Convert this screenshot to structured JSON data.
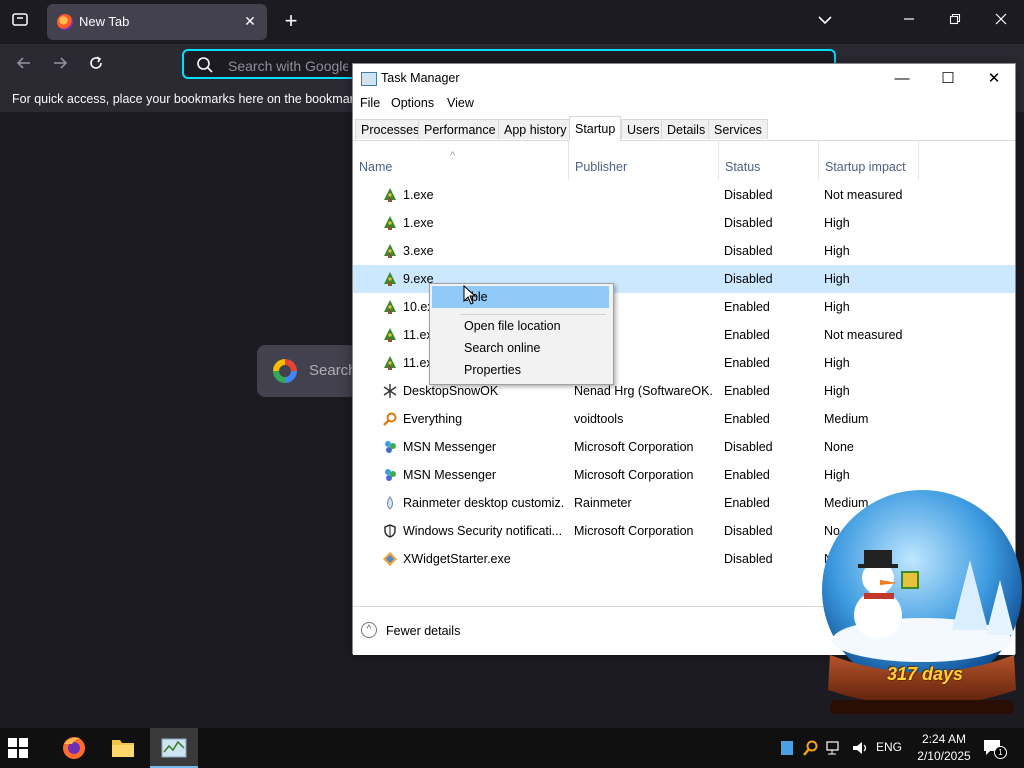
{
  "browser": {
    "tab": {
      "title": "New Tab",
      "close": "✕"
    },
    "new_tab": "+",
    "urlbar": {
      "placeholder": "Search with Google"
    },
    "bookmarks_hint": "For quick access, place your bookmarks here on the bookmarks",
    "newtab_search_placeholder": "Search"
  },
  "task_manager": {
    "title": "Task Manager",
    "window_controls": {
      "minimize": "—",
      "maximize": "☐",
      "close": "✕"
    },
    "menu": [
      "File",
      "Options",
      "View"
    ],
    "tabs": [
      "Processes",
      "Performance",
      "App history",
      "Startup",
      "Users",
      "Details",
      "Services"
    ],
    "active_tab": "Startup",
    "columns": {
      "name": "Name",
      "publisher": "Publisher",
      "status": "Status",
      "impact": "Startup impact"
    },
    "rows": [
      {
        "name": "1.exe",
        "publisher": "",
        "status": "Disabled",
        "impact": "Not measured",
        "icon": "tree-icon"
      },
      {
        "name": "1.exe",
        "publisher": "",
        "status": "Disabled",
        "impact": "High",
        "icon": "tree-icon"
      },
      {
        "name": "3.exe",
        "publisher": "",
        "status": "Disabled",
        "impact": "High",
        "icon": "tree-icon"
      },
      {
        "name": "9.exe",
        "publisher": "",
        "status": "Disabled",
        "impact": "High",
        "icon": "tree-icon"
      },
      {
        "name": "10.exe",
        "publisher": "",
        "status": "Enabled",
        "impact": "High",
        "icon": "tree-icon"
      },
      {
        "name": "11.exe",
        "publisher": "",
        "status": "Enabled",
        "impact": "Not measured",
        "icon": "tree-icon"
      },
      {
        "name": "11.exe",
        "publisher": "",
        "status": "Enabled",
        "impact": "High",
        "icon": "tree-icon"
      },
      {
        "name": "DesktopSnowOK",
        "publisher": "Nenad Hrg (SoftwareOK...",
        "status": "Enabled",
        "impact": "High",
        "icon": "snowflake-icon"
      },
      {
        "name": "Everything",
        "publisher": "voidtools",
        "status": "Enabled",
        "impact": "Medium",
        "icon": "magnifier-icon"
      },
      {
        "name": "MSN Messenger",
        "publisher": "Microsoft Corporation",
        "status": "Disabled",
        "impact": "None",
        "icon": "messenger-icon"
      },
      {
        "name": "MSN Messenger",
        "publisher": "Microsoft Corporation",
        "status": "Enabled",
        "impact": "High",
        "icon": "messenger-icon"
      },
      {
        "name": "Rainmeter desktop customiz...",
        "publisher": "Rainmeter",
        "status": "Enabled",
        "impact": "Medium",
        "icon": "droplet-icon"
      },
      {
        "name": "Windows Security notificati...",
        "publisher": "Microsoft Corporation",
        "status": "Disabled",
        "impact": "No",
        "icon": "shield-icon"
      },
      {
        "name": "XWidgetStarter.exe",
        "publisher": "",
        "status": "Disabled",
        "impact": "N",
        "icon": "xwidget-icon"
      }
    ],
    "selected_row": 3,
    "footer": {
      "label": "Fewer details"
    }
  },
  "context_menu": {
    "items": [
      "able",
      "Open file location",
      "Search online",
      "Properties"
    ]
  },
  "snow_globe": {
    "days_text": "317 days"
  },
  "taskbar": {
    "language": "ENG",
    "time": "2:24 AM",
    "date": "2/10/2025",
    "notifications": "1"
  },
  "colors": {
    "accent": "#00ddff",
    "selection": "#cce8ff",
    "menu_highlight": "#91c9f7"
  }
}
